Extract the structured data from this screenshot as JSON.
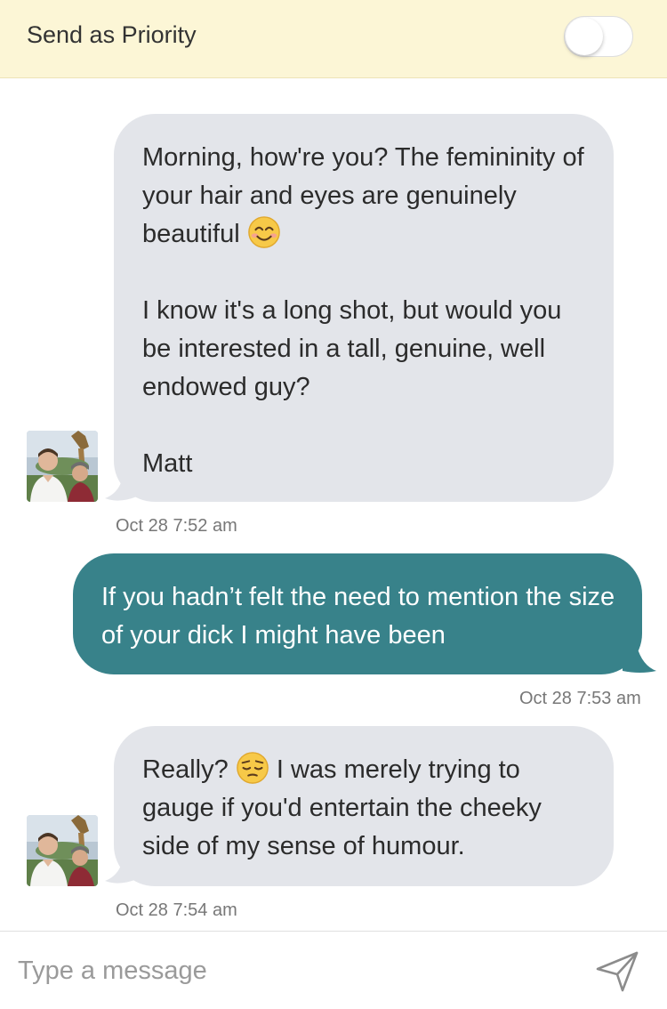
{
  "priority": {
    "label": "Send as Priority",
    "toggle_on": false
  },
  "messages": [
    {
      "direction": "incoming",
      "paragraphs": [
        "Morning, how're you? The femininity of your hair and eyes are genuinely beautiful",
        "I know it's a long shot, but would you be interested in a tall, genuine, well endowed guy?",
        "Matt"
      ],
      "emoji": "smiling-face-emoji",
      "timestamp": "Oct 28 7:52 am"
    },
    {
      "direction": "outgoing",
      "text": "If you hadn’t felt the need to mention the size of your dick I might have been",
      "timestamp": "Oct 28 7:53 am"
    },
    {
      "direction": "incoming",
      "text_before_emoji": "Really?",
      "emoji": "pensive-face-emoji",
      "text_after_emoji": " I was merely trying to gauge if you'd entertain the cheeky side of my sense of humour.",
      "timestamp": "Oct 28 7:54 am"
    }
  ],
  "composer": {
    "placeholder": "Type a message",
    "send_icon": "send-icon"
  },
  "colors": {
    "priority_bar": "#fcf6d6",
    "incoming_bubble": "#e3e5ea",
    "outgoing_bubble": "#38828a"
  }
}
